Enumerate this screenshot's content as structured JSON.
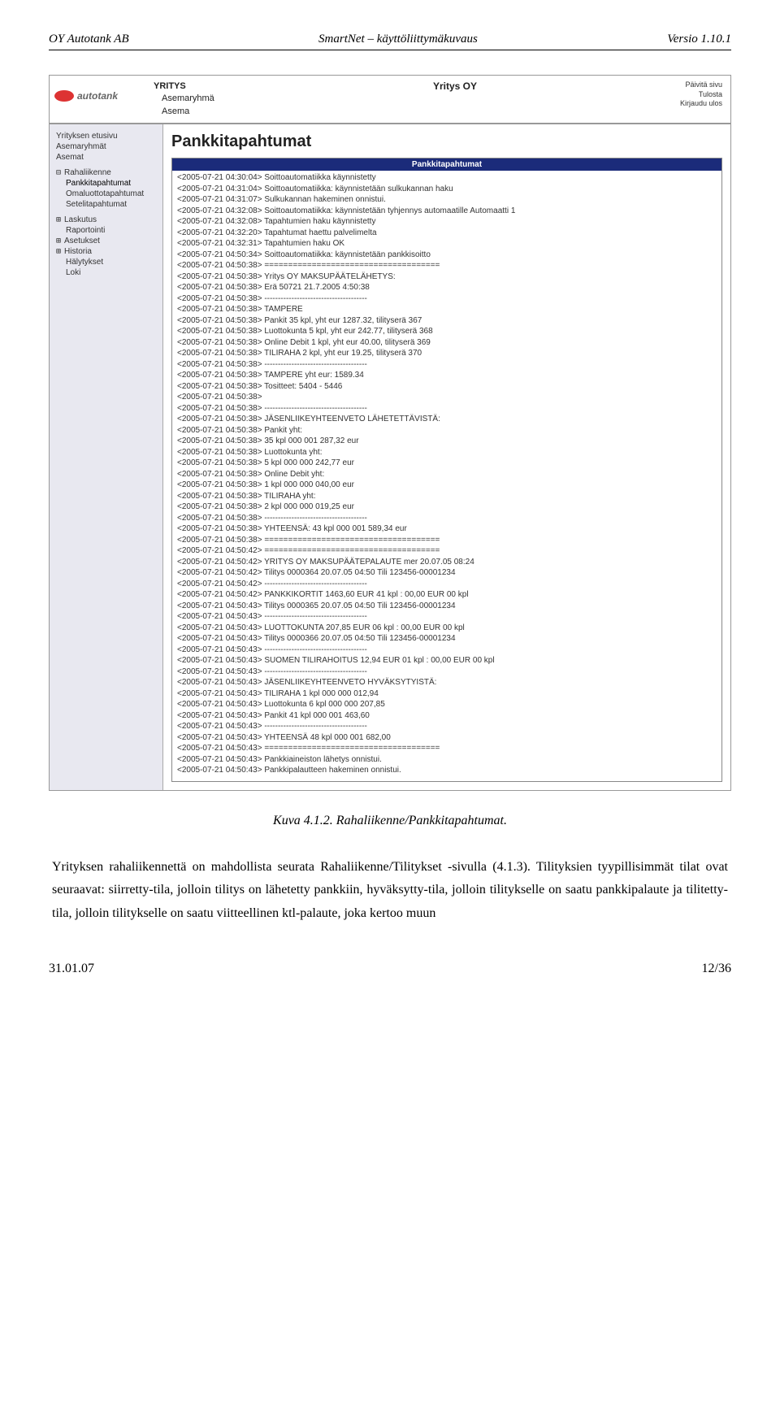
{
  "doc": {
    "header_left": "OY Autotank AB",
    "header_center": "SmartNet – käyttöliittymäkuvaus",
    "header_right": "Versio 1.10.1",
    "footer_left": "31.01.07",
    "footer_right": "12/36",
    "caption": "Kuva 4.1.2. Rahaliikenne/Pankkitapahtumat.",
    "body": "Yrityksen rahaliikennettä on mahdollista seurata Rahaliikenne/Tilitykset -sivulla (4.1.3). Tilityksien tyypillisimmät tilat ovat seuraavat: siirretty-tila, jolloin tilitys on lähetetty pankkiin, hyväksytty-tila, jolloin tilitykselle on saatu pankkipalaute ja tilitetty-tila, jolloin tilitykselle on saatu viitteellinen ktl-palaute, joka kertoo muun"
  },
  "ui": {
    "logo_text": "autotank",
    "crumb1": "YRITYS",
    "crumb2": "Asemaryhmä",
    "crumb3": "Asema",
    "company_title": "Yritys OY",
    "util1": "Päivitä sivu",
    "util2": "Tulosta",
    "util3": "Kirjaudu ulos",
    "side": {
      "s1": "Yrityksen etusivu",
      "s2": "Asemaryhmät",
      "s3": "Asemat",
      "g1": "Rahaliikenne",
      "g1a": "Pankkitapahtumat",
      "g1b": "Omaluottotapahtumat",
      "g1c": "Setelitapahtumat",
      "g2": "Laskutus",
      "g2a": "Raportointi",
      "g3": "Asetukset",
      "g4": "Historia",
      "g5": "Hälytykset",
      "g6": "Loki"
    },
    "page_title": "Pankkitapahtumat",
    "panel_title": "Pankkitapahtumat",
    "log": [
      "<2005-07-21 04:30:04> Soittoautomatiikka käynnistetty",
      "<2005-07-21 04:31:04> Soittoautomatiikka: käynnistetään sulkukannan haku",
      "<2005-07-21 04:31:07> Sulkukannan hakeminen onnistui.",
      "<2005-07-21 04:32:08> Soittoautomatiikka: käynnistetään tyhjennys automaatille Automaatti 1",
      "<2005-07-21 04:32:08> Tapahtumien haku käynnistetty",
      "<2005-07-21 04:32:20> Tapahtumat haettu palvelimelta",
      "<2005-07-21 04:32:31> Tapahtumien haku OK",
      "<2005-07-21 04:50:34> Soittoautomatiikka: käynnistetään pankkisoitto",
      "<2005-07-21 04:50:38> =====================================",
      "<2005-07-21 04:50:38> Yritys OY MAKSUPÄÄTELÄHETYS:",
      "<2005-07-21 04:50:38> Erä 50721 21.7.2005 4:50:38",
      "<2005-07-21 04:50:38> --------------------------------------",
      "<2005-07-21 04:50:38> TAMPERE",
      "<2005-07-21 04:50:38> Pankit 35 kpl, yht eur 1287.32, tilityserä 367",
      "<2005-07-21 04:50:38> Luottokunta 5 kpl, yht eur 242.77, tilityserä 368",
      "<2005-07-21 04:50:38> Online Debit 1 kpl, yht eur 40.00, tilityserä 369",
      "<2005-07-21 04:50:38> TILIRAHA 2 kpl, yht eur 19.25, tilityserä 370",
      "<2005-07-21 04:50:38> --------------------------------------",
      "<2005-07-21 04:50:38> TAMPERE yht eur: 1589.34",
      "<2005-07-21 04:50:38> Tositteet: 5404 - 5446",
      "<2005-07-21 04:50:38>",
      "<2005-07-21 04:50:38> --------------------------------------",
      "<2005-07-21 04:50:38> JÄSENLIIKEYHTEENVETO LÄHETETTÄVISTÄ:",
      "<2005-07-21 04:50:38> Pankit yht:",
      "<2005-07-21 04:50:38> 35 kpl 000 001 287,32 eur",
      "<2005-07-21 04:50:38> Luottokunta yht:",
      "<2005-07-21 04:50:38> 5 kpl 000 000 242,77 eur",
      "<2005-07-21 04:50:38> Online Debit yht:",
      "<2005-07-21 04:50:38> 1 kpl 000 000 040,00 eur",
      "<2005-07-21 04:50:38> TILIRAHA yht:",
      "<2005-07-21 04:50:38> 2 kpl 000 000 019,25 eur",
      "<2005-07-21 04:50:38> --------------------------------------",
      "<2005-07-21 04:50:38> YHTEENSÄ: 43 kpl 000 001 589,34 eur",
      "<2005-07-21 04:50:38> =====================================",
      "<2005-07-21 04:50:42> =====================================",
      "<2005-07-21 04:50:42> YRITYS OY MAKSUPÄÄTEPALAUTE mer 20.07.05 08:24",
      "<2005-07-21 04:50:42> Tilitys 0000364 20.07.05 04:50 Tili 123456-00001234",
      "<2005-07-21 04:50:42> --------------------------------------",
      "<2005-07-21 04:50:42> PANKKIKORTIT 1463,60 EUR 41 kpl : 00,00 EUR 00 kpl",
      "<2005-07-21 04:50:43> Tilitys 0000365 20.07.05 04:50 Tili 123456-00001234",
      "<2005-07-21 04:50:43> --------------------------------------",
      "<2005-07-21 04:50:43> LUOTTOKUNTA 207,85 EUR 06 kpl : 00,00 EUR 00 kpl",
      "<2005-07-21 04:50:43> Tilitys 0000366 20.07.05 04:50 Tili 123456-00001234",
      "<2005-07-21 04:50:43> --------------------------------------",
      "<2005-07-21 04:50:43> SUOMEN TILIRAHOITUS 12,94 EUR 01 kpl : 00,00 EUR 00 kpl",
      "<2005-07-21 04:50:43> --------------------------------------",
      "<2005-07-21 04:50:43> JÄSENLIIKEYHTEENVETO HYVÄKSYTYISTÄ:",
      "<2005-07-21 04:50:43> TILIRAHA 1 kpl 000 000 012,94",
      "<2005-07-21 04:50:43> Luottokunta 6 kpl 000 000 207,85",
      "<2005-07-21 04:50:43> Pankit 41 kpl 000 001 463,60",
      "<2005-07-21 04:50:43> --------------------------------------",
      "<2005-07-21 04:50:43> YHTEENSÄ 48 kpl 000 001 682,00",
      "<2005-07-21 04:50:43> =====================================",
      "<2005-07-21 04:50:43> Pankkiaineiston lähetys onnistui.",
      "<2005-07-21 04:50:43> Pankkipalautteen hakeminen onnistui."
    ]
  }
}
